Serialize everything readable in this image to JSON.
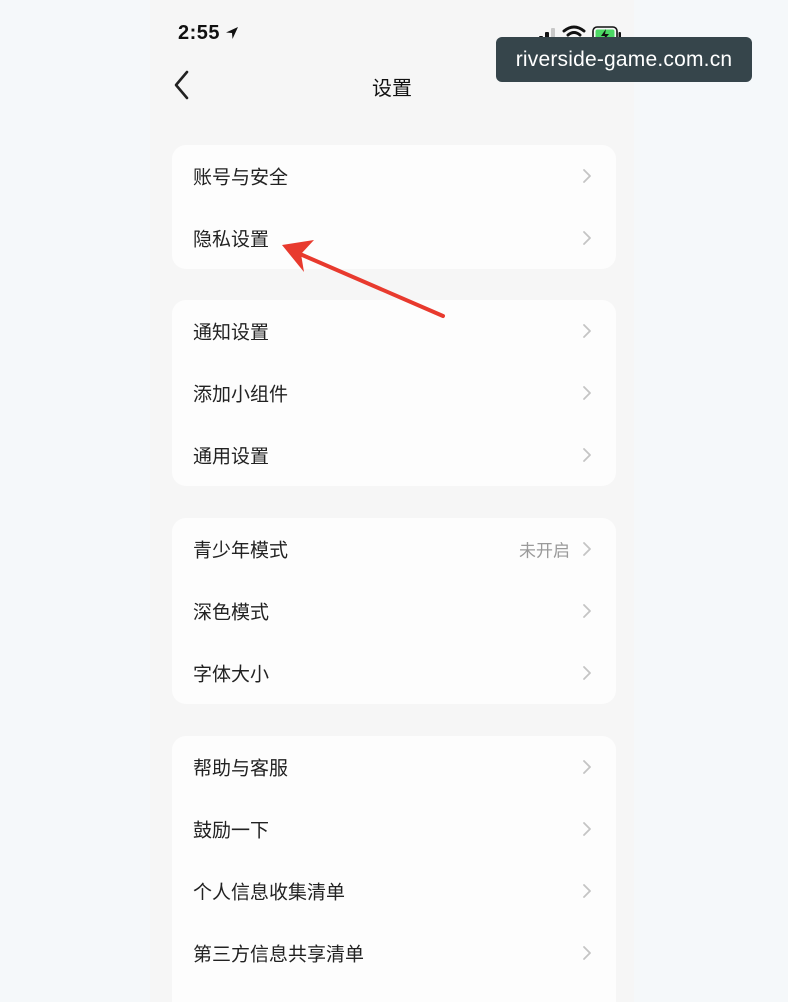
{
  "status_bar": {
    "time": "2:55"
  },
  "nav": {
    "title": "设置"
  },
  "groups": [
    {
      "items": [
        {
          "label": "账号与安全",
          "value": ""
        },
        {
          "label": "隐私设置",
          "value": ""
        }
      ]
    },
    {
      "items": [
        {
          "label": "通知设置",
          "value": ""
        },
        {
          "label": "添加小组件",
          "value": ""
        },
        {
          "label": "通用设置",
          "value": ""
        }
      ]
    },
    {
      "items": [
        {
          "label": "青少年模式",
          "value": "未开启"
        },
        {
          "label": "深色模式",
          "value": ""
        },
        {
          "label": "字体大小",
          "value": ""
        }
      ]
    },
    {
      "items": [
        {
          "label": "帮助与客服",
          "value": ""
        },
        {
          "label": "鼓励一下",
          "value": ""
        },
        {
          "label": "个人信息收集清单",
          "value": ""
        },
        {
          "label": "第三方信息共享清单",
          "value": ""
        }
      ]
    }
  ],
  "watermark": {
    "text": "riverside-game.com.cn"
  },
  "icons": {
    "back": "chevron-left-icon",
    "row_arrow": "chevron-right-icon",
    "location": "location-arrow-icon",
    "signal": "cellular-signal-icon",
    "wifi": "wifi-icon",
    "battery": "battery-charging-icon"
  },
  "colors": {
    "page_background": "#f6f6f6",
    "card_background": "#fdfdfd",
    "annotation_arrow": "#e83a2e",
    "watermark_background": "#36454b",
    "secondary_text": "#9a9a9a",
    "battery_fill": "#4cd964"
  }
}
